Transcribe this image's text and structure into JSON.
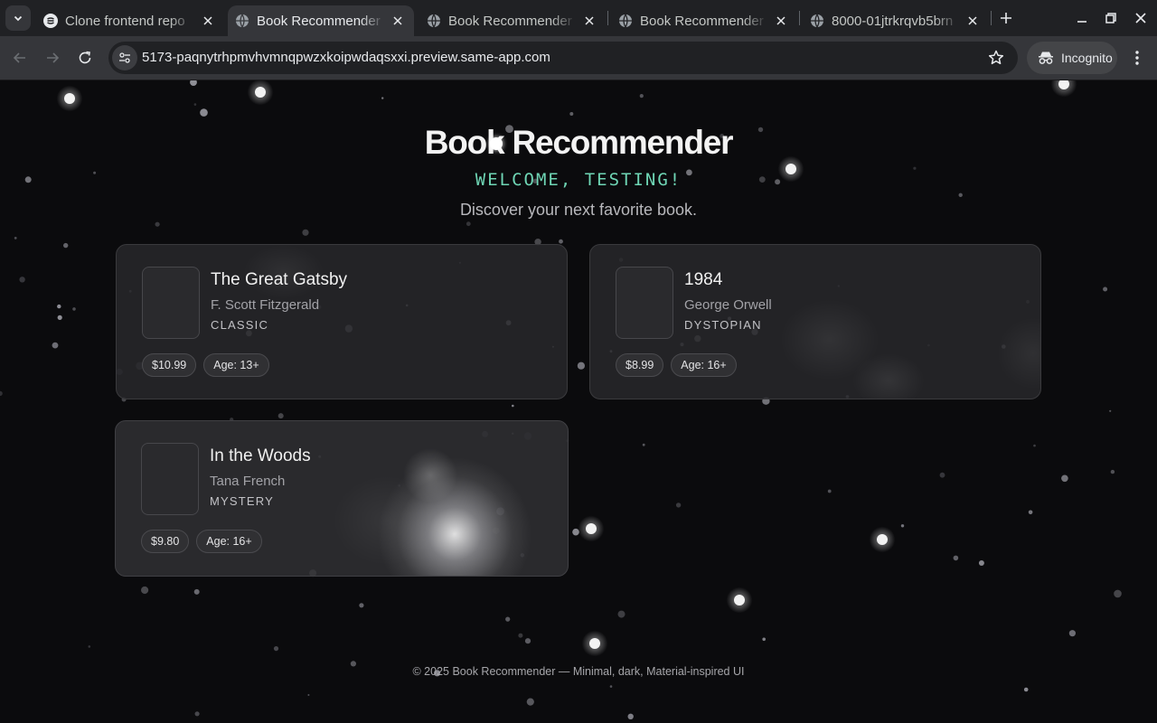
{
  "browser": {
    "tabs": [
      {
        "title": "Clone frontend repo",
        "icon": "same-app-icon",
        "active": false
      },
      {
        "title": "Book Recommender",
        "icon": "globe-icon",
        "active": true
      },
      {
        "title": "Book Recommender",
        "icon": "globe-icon",
        "active": false
      },
      {
        "title": "Book Recommender",
        "icon": "globe-icon",
        "active": false
      },
      {
        "title": "8000-01jtrkrqvb5brn",
        "icon": "globe-icon",
        "active": false
      }
    ],
    "url": "5173-paqnytrhpmvhvmnqpwzxkoipwdaqsxxi.preview.same-app.com",
    "profile_label": "Incognito",
    "colors": {
      "tabstrip": "#202124",
      "toolbar": "#35363a",
      "omnibox": "#202124"
    }
  },
  "page": {
    "title": "Book Recommender",
    "welcome": "WELCOME, TESTING!",
    "tagline": "Discover your next favorite book.",
    "books": [
      {
        "title": "The Great Gatsby",
        "author": "F. Scott Fitzgerald",
        "genre": "CLASSIC",
        "price": "$10.99",
        "age": "Age: 13+"
      },
      {
        "title": "1984",
        "author": "George Orwell",
        "genre": "DYSTOPIAN",
        "price": "$8.99",
        "age": "Age: 16+"
      },
      {
        "title": "In the Woods",
        "author": "Tana French",
        "genre": "MYSTERY",
        "price": "$9.80",
        "age": "Age: 16+"
      }
    ],
    "footer": "© 2025 Book Recommender — Minimal, dark, Material-inspired UI",
    "colors": {
      "background": "#0b0b0d",
      "accent": "#6fd6b5",
      "card": "#28282b"
    }
  }
}
